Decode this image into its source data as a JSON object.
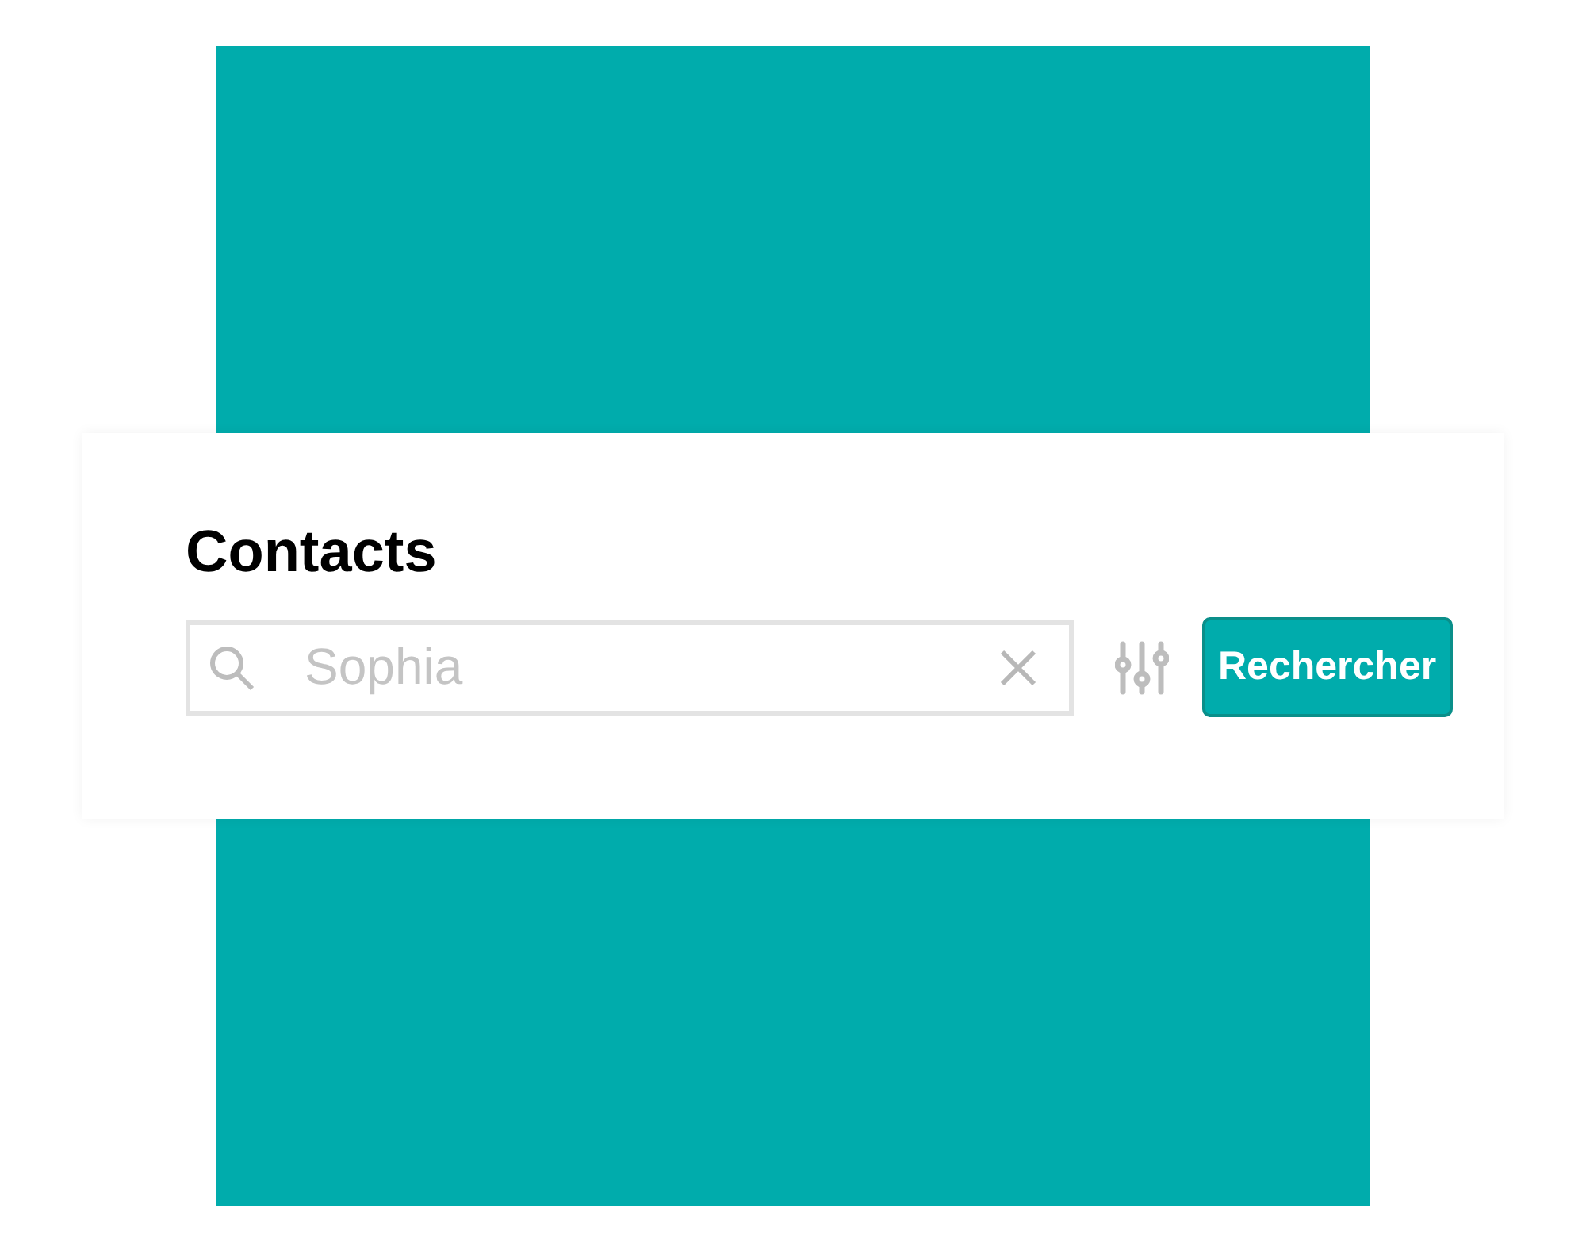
{
  "title": "Contacts",
  "search": {
    "placeholder": "Sophia"
  },
  "buttons": [
    {
      "label": "Rechercher"
    }
  ]
}
